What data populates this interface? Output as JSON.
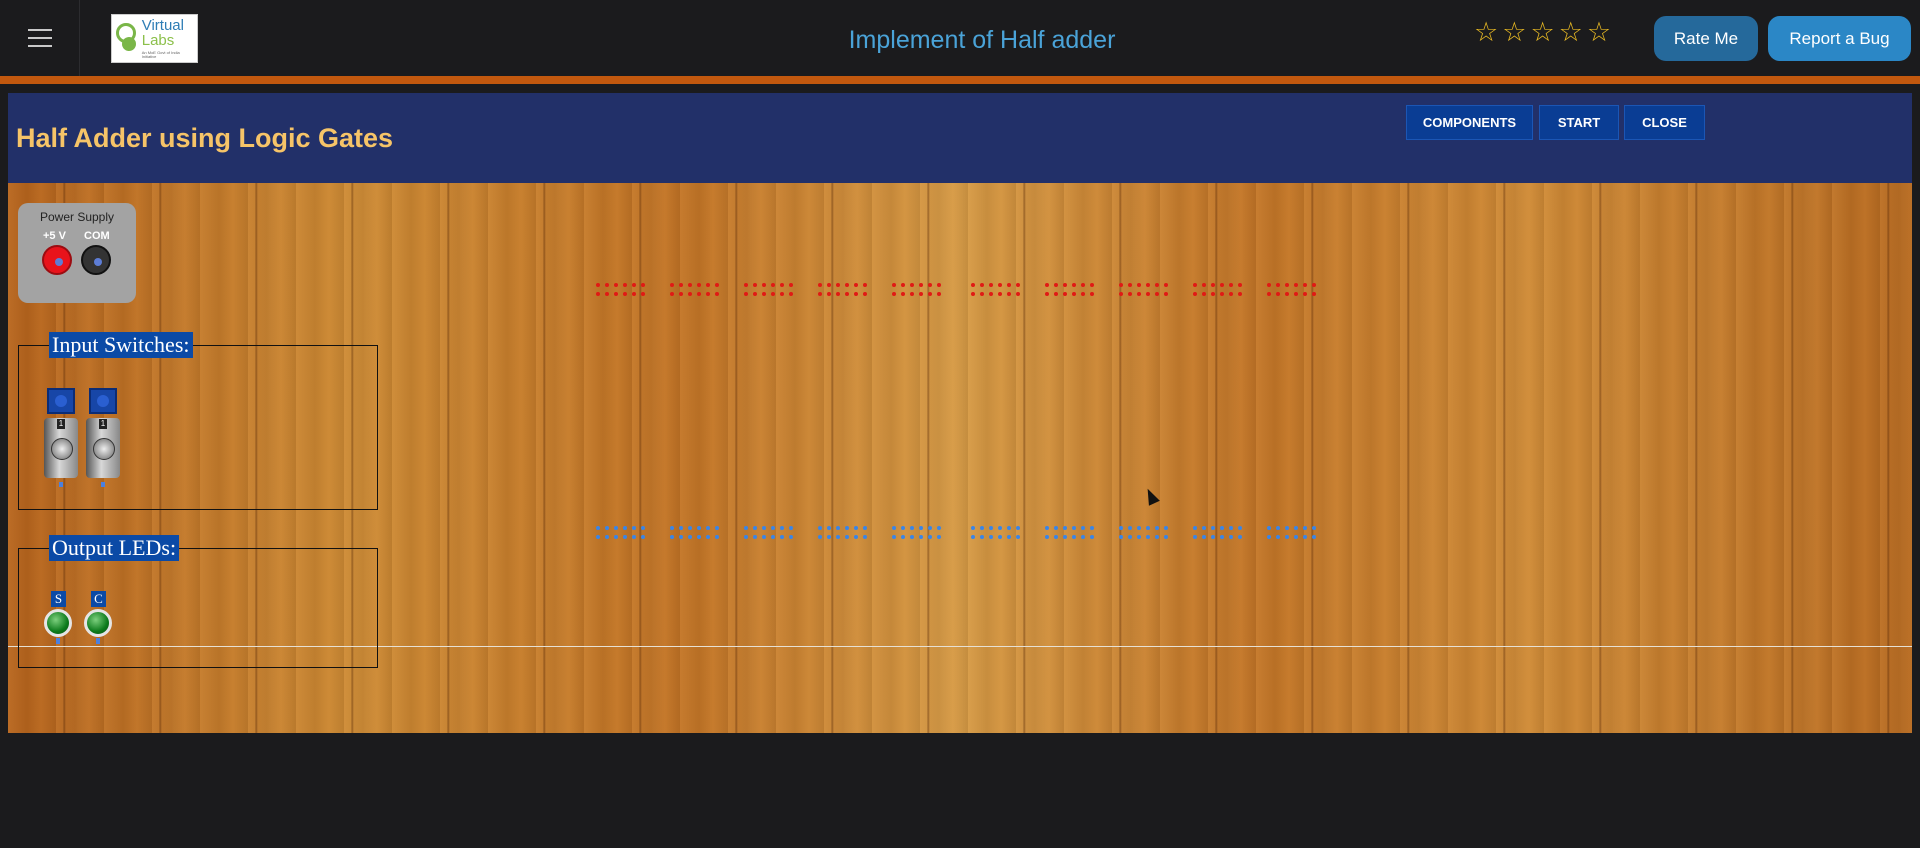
{
  "topbar": {
    "title": "Implement of Half adder",
    "logo": {
      "line1": "Virtual",
      "line2": "Labs",
      "tagline": "An MoE Govt of India Initiative"
    },
    "rating_stars": 5,
    "rate_button": "Rate Me",
    "bug_button": "Report a Bug"
  },
  "experiment": {
    "title": "Half Adder using Logic Gates",
    "buttons": {
      "components": "COMPONENTS",
      "start": "START",
      "close": "CLOSE"
    },
    "power_supply": {
      "title": "Power Supply",
      "plus_label": "+5 V",
      "com_label": "COM"
    },
    "input_switches": {
      "label": "Input Switches:",
      "count": 2
    },
    "output_leds": {
      "label": "Output LEDs:",
      "leds": [
        "S",
        "C"
      ]
    }
  },
  "colors": {
    "accent_title": "#4aa3d8",
    "orange_bar": "#c2580e",
    "header_bg": "#223069",
    "exp_title": "#f6c468",
    "button_blue": "#0a3d94"
  }
}
